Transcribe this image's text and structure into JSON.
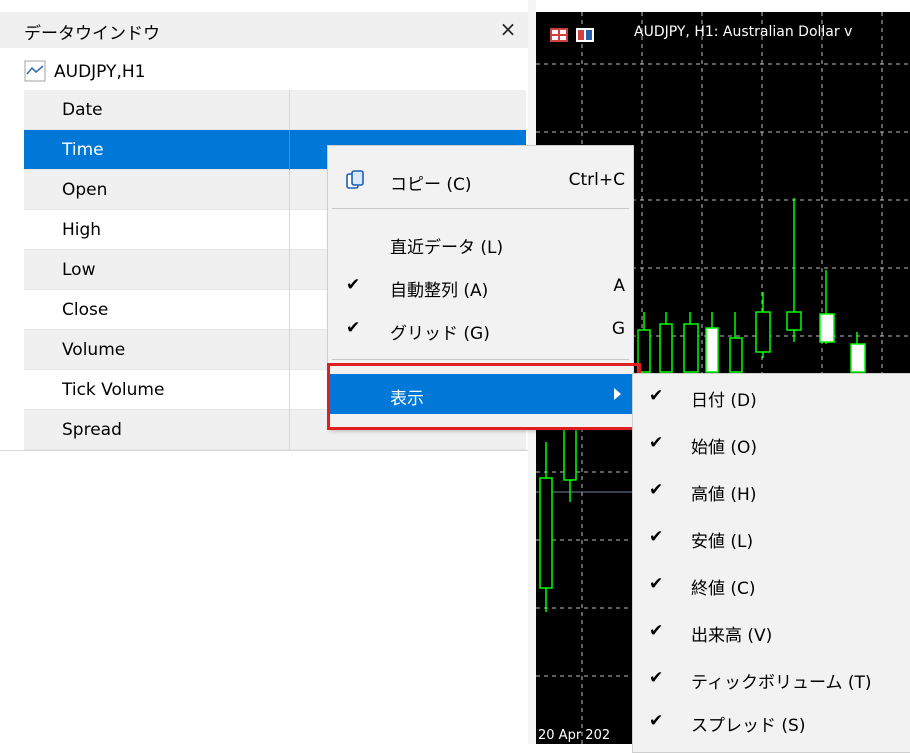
{
  "panel": {
    "title": "データウインドウ",
    "close_label": "×",
    "symbol": "AUDJPY,H1",
    "rows": [
      {
        "label": "Date",
        "value": ""
      },
      {
        "label": "Time",
        "value": ""
      },
      {
        "label": "Open",
        "value": ""
      },
      {
        "label": "High",
        "value": ""
      },
      {
        "label": "Low",
        "value": ""
      },
      {
        "label": "Close",
        "value": ""
      },
      {
        "label": "Volume",
        "value": ""
      },
      {
        "label": "Tick Volume",
        "value": ""
      },
      {
        "label": "Spread",
        "value": ""
      }
    ]
  },
  "chart": {
    "title": "AUDJPY, H1:  Australian Dollar v",
    "date_label": "20 Apr 202",
    "colors": {
      "background": "#000000",
      "candle": "#00ff00",
      "bull_body": "#ffffff",
      "grid": "#c0c0c0"
    }
  },
  "context_menu": {
    "copy_label": "コピー (C)",
    "copy_shortcut": "Ctrl+C",
    "recent_data_label": "直近データ (L)",
    "auto_arrange_label": "自動整列 (A)",
    "auto_arrange_key": "A",
    "grid_label": "グリッド (G)",
    "grid_key": "G",
    "display_label": "表示",
    "check": "✔"
  },
  "sub_menu": {
    "items": [
      {
        "label": "日付 (D)",
        "checked": true
      },
      {
        "label": "始値 (O)",
        "checked": true
      },
      {
        "label": "高値 (H)",
        "checked": true
      },
      {
        "label": "安値 (L)",
        "checked": true
      },
      {
        "label": "終値 (C)",
        "checked": true
      },
      {
        "label": "出来高 (V)",
        "checked": true
      },
      {
        "label": "ティックボリューム (T)",
        "checked": true
      },
      {
        "label": "スプレッド (S)",
        "checked": true
      }
    ]
  },
  "colors": {
    "selection": "#0078d7",
    "highlight_border": "#e02020"
  }
}
